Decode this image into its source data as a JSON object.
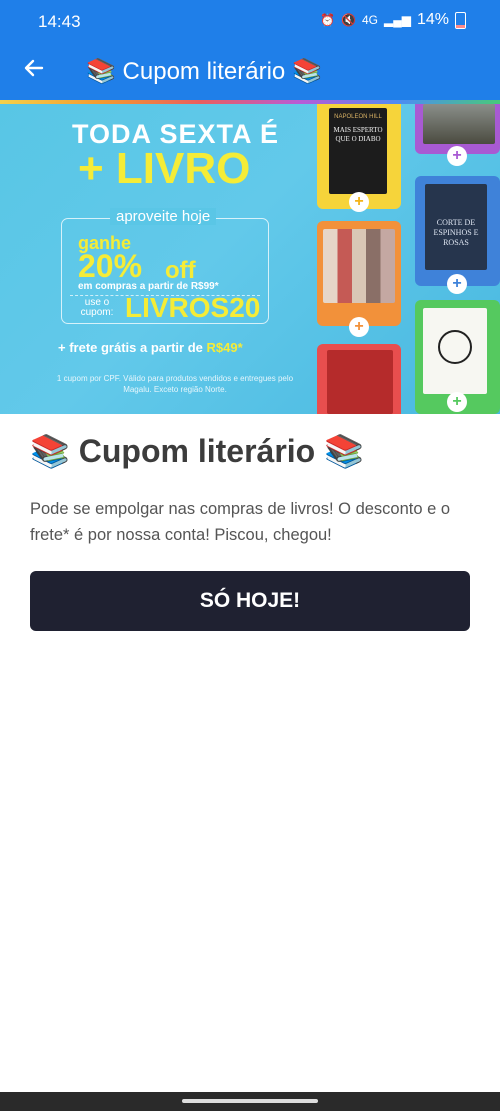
{
  "status_bar": {
    "time": "14:43",
    "battery": "14%",
    "network": "4G"
  },
  "app_bar": {
    "title": "📚 Cupom literário 📚"
  },
  "banner": {
    "headline_1": "TODA SEXTA É",
    "headline_2": "+ LIVRO",
    "tab": "aproveite hoje",
    "ganhe": "ganhe",
    "percent": "20%",
    "off": "off",
    "min_purchase": "em compras a partir de R$99*",
    "use_label": "use o cupom:",
    "coupon_code": "LIVROS20",
    "free_shipping_prefix": "+ frete grátis",
    "free_shipping_mid": " a partir de ",
    "free_shipping_value": "R$49*",
    "disclaimer": "1 cupom por CPF. Válido para produtos vendidos e entregues pelo Magalu. Exceto região Norte.",
    "books": {
      "book1_author": "NAPOLEON HILL",
      "book1_title": "MAIS ESPERTO QUE O DIABO",
      "book3_title": "CORTE DE ESPINHOS E ROSAS"
    }
  },
  "content": {
    "heading": "📚 Cupom literário 📚",
    "description": "Pode se empolgar nas compras de livros! O desconto e o frete* é por nossa conta! Piscou, chegou!",
    "cta_label": "SÓ HOJE!"
  },
  "colors": {
    "app_blue": "#1f7fe9",
    "banner_blue": "#58c6e5",
    "cta_dark": "#1f2131",
    "accent_yellow": "#f5ec37"
  }
}
